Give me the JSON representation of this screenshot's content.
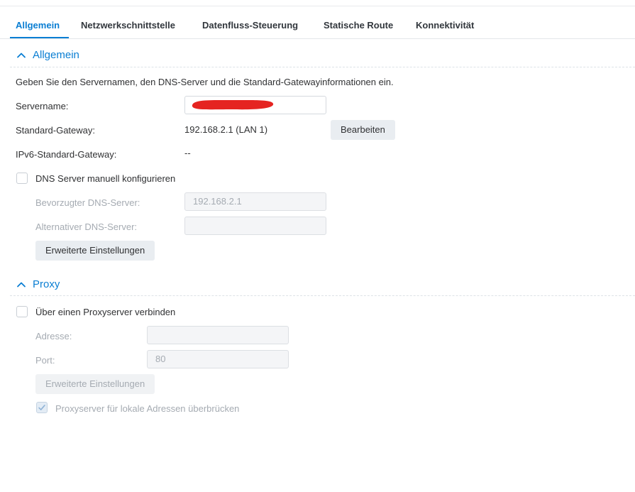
{
  "tabs": [
    {
      "label": "Allgemein",
      "active": true
    },
    {
      "label": "Netzwerkschnittstelle",
      "active": false
    },
    {
      "label": "Datenfluss-Steuerung",
      "active": false
    },
    {
      "label": "Statische Route",
      "active": false
    },
    {
      "label": "Konnektivität",
      "active": false
    }
  ],
  "general": {
    "title": "Allgemein",
    "description": "Geben Sie den Servernamen, den DNS-Server und die Standard-Gatewayinformationen ein.",
    "server_name_label": "Servername:",
    "server_name_value": "",
    "gateway_label": "Standard-Gateway:",
    "gateway_value": "192.168.2.1 (LAN 1)",
    "edit_button": "Bearbeiten",
    "ipv6_gateway_label": "IPv6-Standard-Gateway:",
    "ipv6_gateway_value": "--",
    "dns_manual_label": "DNS Server manuell konfigurieren",
    "dns_manual_checked": false,
    "preferred_dns_label": "Bevorzugter DNS-Server:",
    "preferred_dns_value": "192.168.2.1",
    "alternative_dns_label": "Alternativer DNS-Server:",
    "alternative_dns_value": "",
    "advanced_button": "Erweiterte Einstellungen"
  },
  "proxy": {
    "title": "Proxy",
    "connect_label": "Über einen Proxyserver verbinden",
    "connect_checked": false,
    "address_label": "Adresse:",
    "address_value": "",
    "port_label": "Port:",
    "port_value": "80",
    "advanced_button": "Erweiterte Einstellungen",
    "bypass_local_label": "Proxyserver für lokale Adressen überbrücken",
    "bypass_local_checked": true
  },
  "colors": {
    "accent": "#0a7ed3",
    "redaction": "#e52421"
  },
  "icons": {
    "section_toggle": "chevron-up-icon",
    "check": "checkmark-icon"
  }
}
